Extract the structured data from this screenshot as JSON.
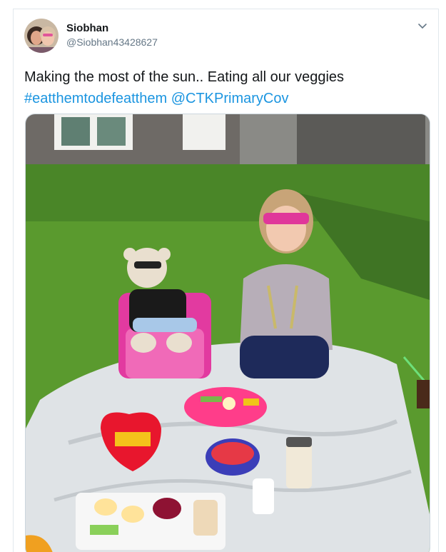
{
  "tweet": {
    "author": {
      "display_name": "Siobhan",
      "handle": "@Siobhan43428627",
      "avatar_icon": "profile-photo"
    },
    "more_icon": "chevron-down-icon",
    "text": "Making the most of the sun.. Eating all our veggies",
    "hashtag": "#eatthemtodefeatthem",
    "mention": "@CTKPrimaryCov",
    "colors": {
      "link": "#1b95e0",
      "handle": "#657786",
      "text": "#14171a"
    },
    "media": {
      "description_icon": "photo-girl-picnic-in-garden"
    }
  }
}
